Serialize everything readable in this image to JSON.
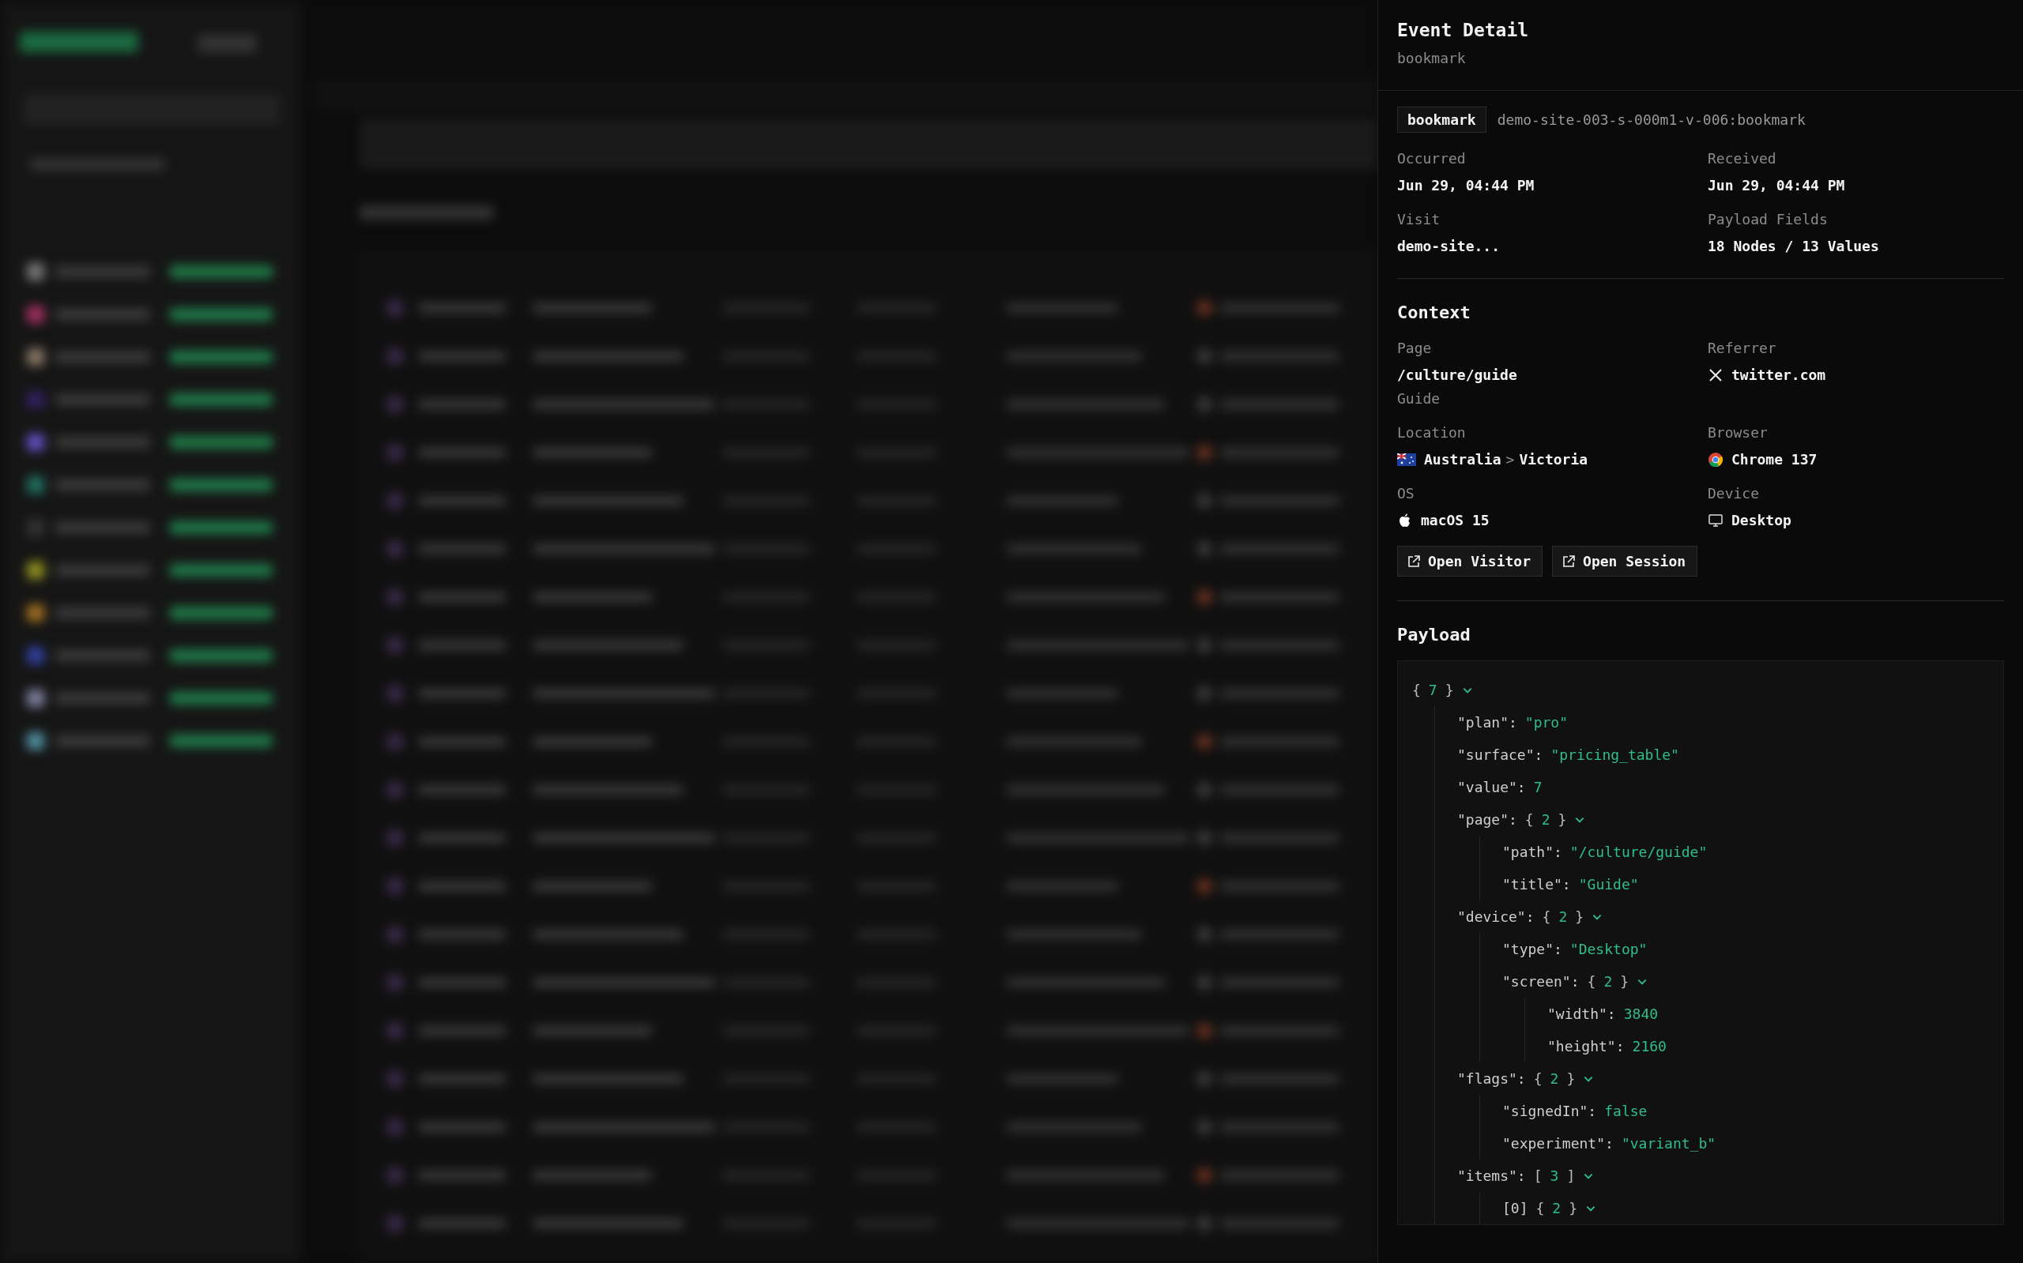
{
  "panel": {
    "title": "Event Detail",
    "subtitle": "bookmark",
    "event_tag": "bookmark",
    "event_id": "demo-site-003-s-000m1-v-006:bookmark",
    "facts": [
      {
        "label": "Occurred",
        "value": "Jun 29, 04:44 PM"
      },
      {
        "label": "Received",
        "value": "Jun 29, 04:44 PM"
      },
      {
        "label": "Visit",
        "value": "demo-site..."
      },
      {
        "label": "Payload Fields",
        "value": "18 Nodes / 13 Values"
      }
    ],
    "context_title": "Context",
    "context": [
      {
        "label": "Page",
        "kind": "page",
        "value": "/culture/guide",
        "note": "Guide"
      },
      {
        "label": "Referrer",
        "kind": "x",
        "value": "twitter.com"
      },
      {
        "label": "Location",
        "kind": "flag",
        "value": "Australia",
        "separator": ">",
        "region": "Victoria"
      },
      {
        "label": "Browser",
        "kind": "chrome",
        "value": "Chrome 137"
      },
      {
        "label": "OS",
        "kind": "apple",
        "value": "macOS 15"
      },
      {
        "label": "Device",
        "kind": "monitor",
        "value": "Desktop"
      }
    ],
    "buttons": [
      "Open Visitor",
      "Open Session"
    ],
    "payload_title": "Payload",
    "payload": {
      "kind": "object",
      "open": "{",
      "count": "7",
      "close": "}",
      "expanded": true,
      "children": [
        {
          "key": "\"plan\":",
          "kind": "string",
          "value": "\"pro\""
        },
        {
          "key": "\"surface\":",
          "kind": "string",
          "value": "\"pricing_table\""
        },
        {
          "key": "\"value\":",
          "kind": "number",
          "value": "7"
        },
        {
          "key": "\"page\":",
          "kind": "object",
          "open": "{",
          "count": "2",
          "close": "}",
          "expanded": true,
          "children": [
            {
              "key": "\"path\":",
              "kind": "string",
              "value": "\"/culture/guide\""
            },
            {
              "key": "\"title\":",
              "kind": "string",
              "value": "\"Guide\""
            }
          ]
        },
        {
          "key": "\"device\":",
          "kind": "object",
          "open": "{",
          "count": "2",
          "close": "}",
          "expanded": true,
          "children": [
            {
              "key": "\"type\":",
              "kind": "string",
              "value": "\"Desktop\""
            },
            {
              "key": "\"screen\":",
              "kind": "object",
              "open": "{",
              "count": "2",
              "close": "}",
              "expanded": true,
              "children": [
                {
                  "key": "\"width\":",
                  "kind": "number",
                  "value": "3840"
                },
                {
                  "key": "\"height\":",
                  "kind": "number",
                  "value": "2160"
                }
              ]
            }
          ]
        },
        {
          "key": "\"flags\":",
          "kind": "object",
          "open": "{",
          "count": "2",
          "close": "}",
          "expanded": true,
          "children": [
            {
              "key": "\"signedIn\":",
              "kind": "boolean",
              "value": "false"
            },
            {
              "key": "\"experiment\":",
              "kind": "string",
              "value": "\"variant_b\""
            }
          ]
        },
        {
          "key": "\"items\":",
          "kind": "array",
          "open": "[",
          "count": "3",
          "close": "]",
          "expanded": true,
          "children": [
            {
              "key": "[0]",
              "kind": "object",
              "open": "{",
              "count": "2",
              "close": "}",
              "expanded": true
            }
          ]
        }
      ]
    }
  }
}
